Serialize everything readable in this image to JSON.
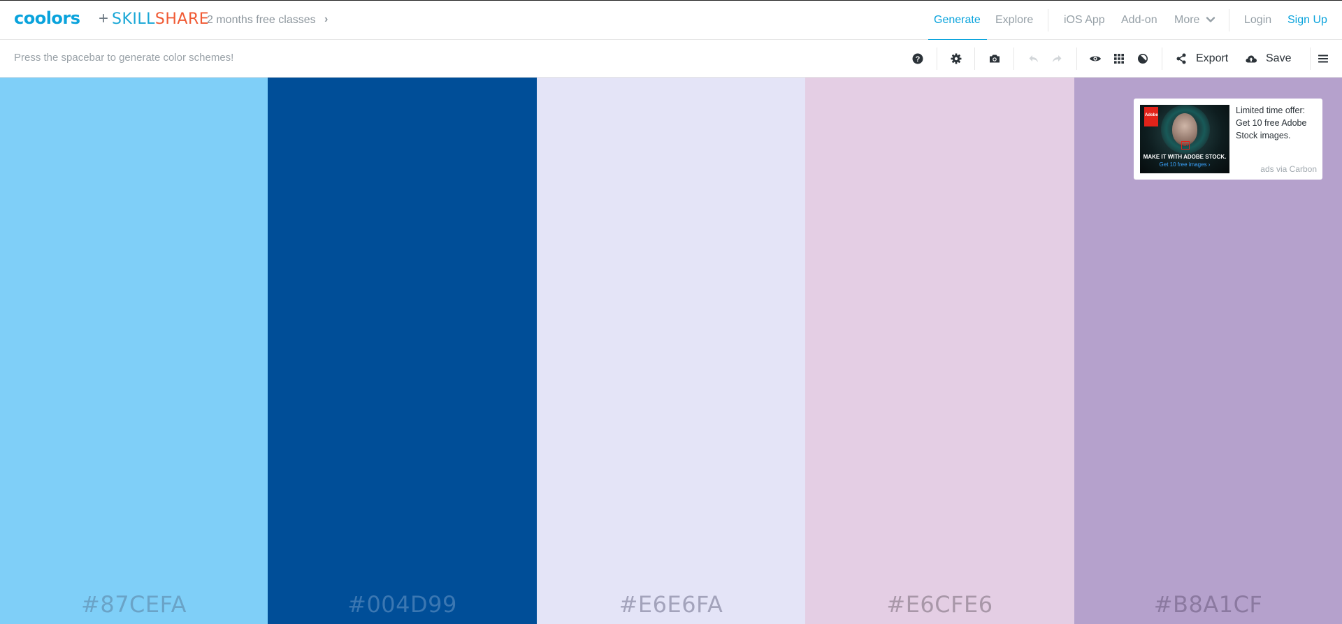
{
  "header": {
    "logo": "coolors",
    "plus": "+",
    "partner_a": "SKILL",
    "partner_b": "SHARE",
    "promo": "2 months free classes",
    "promo_chevron": "›",
    "nav": [
      {
        "label": "Generate",
        "active": true
      },
      {
        "label": "Explore"
      },
      {
        "label": "iOS App"
      },
      {
        "label": "Add-on"
      },
      {
        "label": "More"
      },
      {
        "label": "Login"
      },
      {
        "label": "Sign Up"
      }
    ]
  },
  "toolbar": {
    "hint": "Press the spacebar to generate color schemes!",
    "export_label": "Export",
    "save_label": "Save",
    "icons": [
      "help-icon",
      "gear-icon",
      "camera-icon",
      "undo-icon",
      "redo-icon",
      "eye-icon",
      "grid-icon",
      "contrast-icon",
      "share-icon",
      "cloud-upload-icon",
      "menu-icon"
    ]
  },
  "palette": [
    {
      "hex": "#87CEFA",
      "color": "#7fcff8",
      "text_color": "#6aa3c7"
    },
    {
      "hex": "#004D99",
      "color": "#004e98",
      "text_color": "#3b77b2"
    },
    {
      "hex": "#E6E6FA",
      "color": "#e4e4f7",
      "text_color": "#a3a3bb"
    },
    {
      "hex": "#E6CFE6",
      "color": "#e4cee4",
      "text_color": "#a897a8"
    },
    {
      "hex": "#B8A1CF",
      "color": "#b5a1cc",
      "text_color": "#8b79a0"
    }
  ],
  "ad": {
    "text": "Limited time offer: Get 10 free Adobe Stock images.",
    "via": "ads via Carbon",
    "image_logo": "Adobe",
    "image_badge": "St",
    "image_headline": "MAKE IT WITH ADOBE STOCK.",
    "image_cta": "Get 10 free images ›"
  },
  "colors": {
    "accent": "#0aa3dc",
    "skillshare_blue": "#19a7d6",
    "skillshare_orange": "#f05a34"
  }
}
